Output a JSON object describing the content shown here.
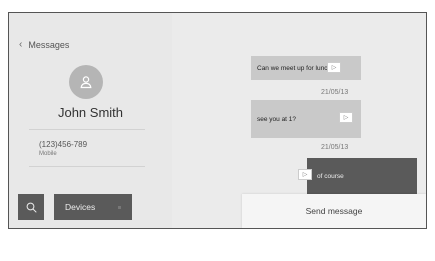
{
  "header": {
    "back_label": "Messages"
  },
  "contact": {
    "name": "John Smith",
    "phone": "(123)456-789",
    "phone_type": "Mobile"
  },
  "buttons": {
    "devices_label": "Devices",
    "send_label": "Send message"
  },
  "messages": [
    {
      "text": "Can we meet up for lunch?",
      "direction": "incoming",
      "date": "21/05/13"
    },
    {
      "text": "see you at 1?",
      "direction": "incoming",
      "date": "21/05/13"
    },
    {
      "text": "of course",
      "direction": "outgoing"
    }
  ],
  "icons": {
    "back": "chevron-left-icon",
    "avatar": "person-icon",
    "search": "search-icon",
    "play": "play-icon"
  },
  "colors": {
    "dark_button": "#5a5a5a",
    "incoming_bubble": "#c9c9c9",
    "outgoing_bubble": "#5a5a5a",
    "panel": "#e8e8e8"
  }
}
